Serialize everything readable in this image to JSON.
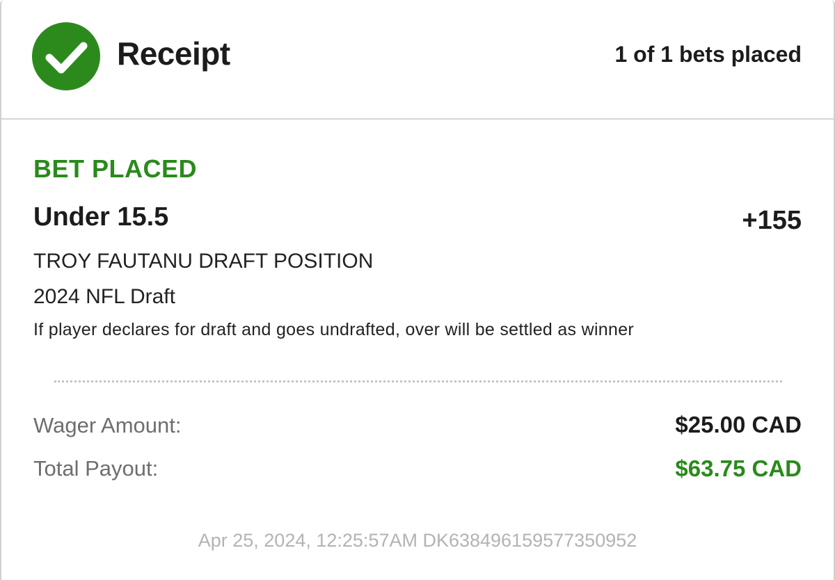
{
  "header": {
    "title": "Receipt",
    "bets_placed": "1 of 1 bets placed",
    "icon": "check-circle-icon"
  },
  "bet": {
    "status": "BET PLACED",
    "selection": "Under 15.5",
    "odds": "+155",
    "market": "TROY FAUTANU DRAFT POSITION",
    "event": "2024 NFL Draft",
    "rule_note": "If player declares for draft and goes undrafted, over will be settled as winner"
  },
  "summary": {
    "wager_label": "Wager Amount:",
    "wager_value": "$25.00 CAD",
    "payout_label": "Total Payout:",
    "payout_value": "$63.75 CAD"
  },
  "footer": {
    "timestamp_id": "Apr 25, 2024, 12:25:57AM DK638496159577350952"
  },
  "colors": {
    "success_green": "#2a8a1c",
    "text_dark": "#1c1c1c",
    "muted_gray": "#6e6e6e",
    "footer_gray": "#b3b3b3"
  }
}
